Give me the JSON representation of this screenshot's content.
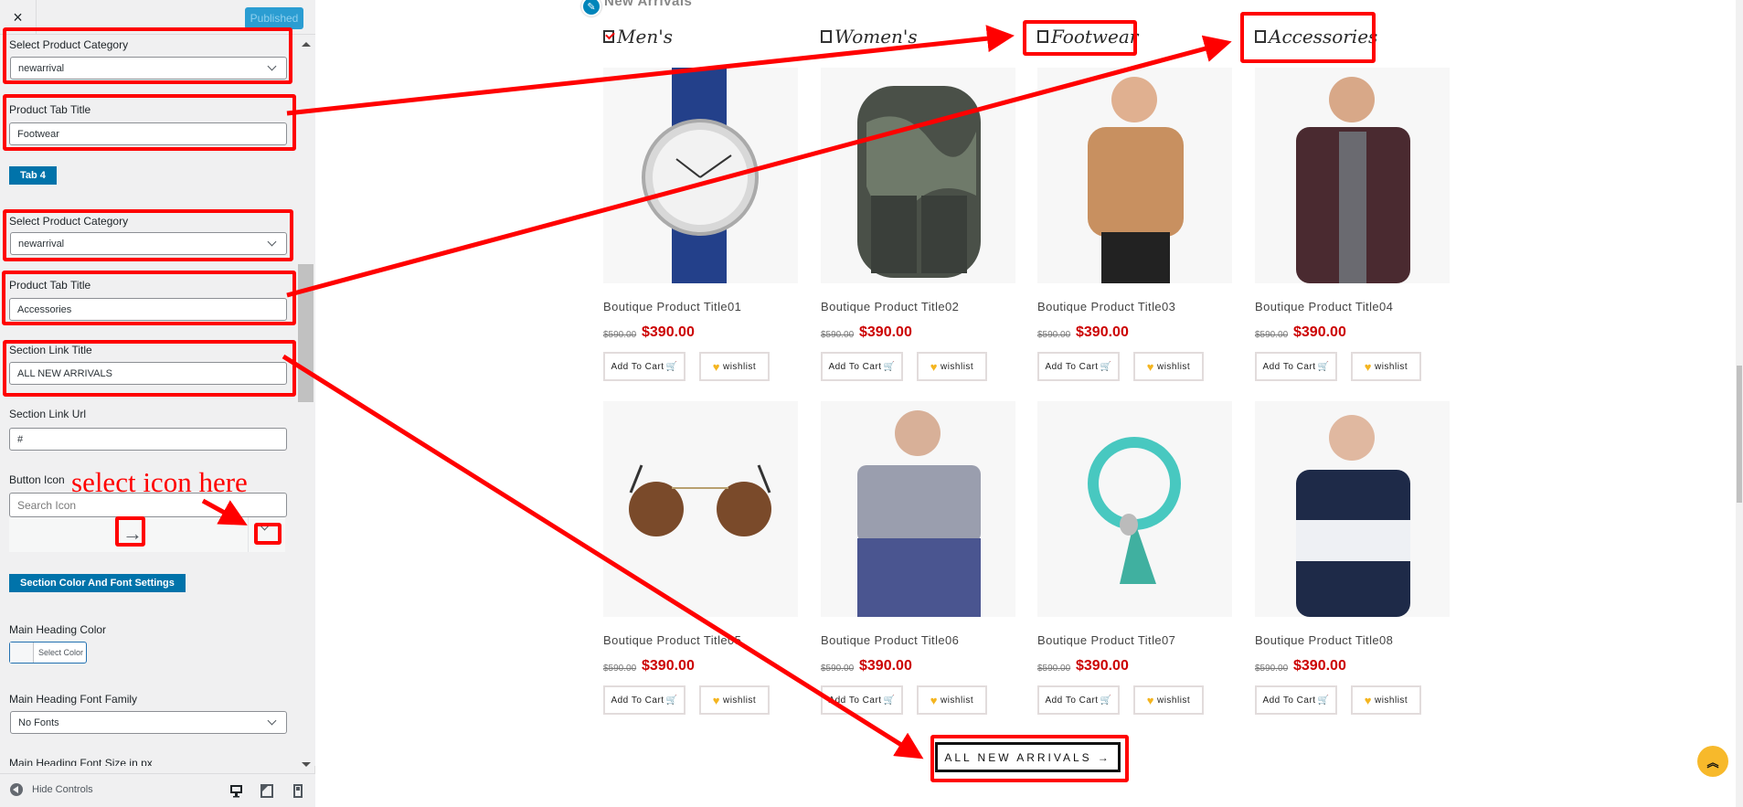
{
  "sidebar": {
    "close_icon": "×",
    "publish_label": "Published",
    "fields": {
      "cat1_label": "Select Product Category",
      "cat1_value": "newarrival",
      "tab3_title_label": "Product Tab Title",
      "tab3_title_value": "Footwear",
      "tab4_button": "Tab 4",
      "cat2_label": "Select Product Category",
      "cat2_value": "newarrival",
      "tab4_title_label": "Product Tab Title",
      "tab4_title_value": "Accessories",
      "link_title_label": "Section Link Title",
      "link_title_value": "ALL NEW ARRIVALS",
      "link_url_label": "Section Link Url",
      "link_url_value": "#",
      "button_icon_label": "Button Icon",
      "icon_search_placeholder": "Search Icon",
      "selected_icon": "→",
      "color_section_button": "Section Color And Font Settings",
      "heading_color_label": "Main Heading Color",
      "select_color_label": "Select Color",
      "heading_font_label": "Main Heading Font Family",
      "heading_font_value": "No Fonts",
      "heading_size_label": "Main Heading Font Size in px"
    },
    "footer": {
      "hide_controls": "Hide Controls",
      "devices": [
        "desktop",
        "tablet",
        "mobile"
      ]
    }
  },
  "annotation": {
    "text": "select icon here",
    "color": "#ff0000"
  },
  "preview": {
    "heading": "New Arrivals",
    "tabs": [
      {
        "label": "Men's",
        "checked": true
      },
      {
        "label": "Women's",
        "checked": false
      },
      {
        "label": "Footwear",
        "checked": false
      },
      {
        "label": "Accessories",
        "checked": false
      }
    ],
    "products": [
      {
        "title": "Boutique Product Title01",
        "old_price": "$590.00",
        "price": "$390.00",
        "image": "watch"
      },
      {
        "title": "Boutique Product Title02",
        "old_price": "$590.00",
        "price": "$390.00",
        "image": "camo-backpack"
      },
      {
        "title": "Boutique Product Title03",
        "old_price": "$590.00",
        "price": "$390.00",
        "image": "woman-ruffle-blouse"
      },
      {
        "title": "Boutique Product Title04",
        "old_price": "$590.00",
        "price": "$390.00",
        "image": "man-plaid-shirt"
      },
      {
        "title": "Boutique Product Title05",
        "old_price": "$590.00",
        "price": "$390.00",
        "image": "aviator-sunglasses"
      },
      {
        "title": "Boutique Product Title06",
        "old_price": "$590.00",
        "price": "$390.00",
        "image": "man-bomber-jacket"
      },
      {
        "title": "Boutique Product Title07",
        "old_price": "$590.00",
        "price": "$390.00",
        "image": "turquoise-bracelet"
      },
      {
        "title": "Boutique Product Title08",
        "old_price": "$590.00",
        "price": "$390.00",
        "image": "woman-striped-top"
      }
    ],
    "add_to_cart": "Add To Cart",
    "wishlist": "wishlist",
    "all_button": "ALL NEW ARRIVALS",
    "colors": {
      "price": "#cc0000",
      "accent": "#f7b92b",
      "wp_blue": "#0073aa"
    }
  }
}
